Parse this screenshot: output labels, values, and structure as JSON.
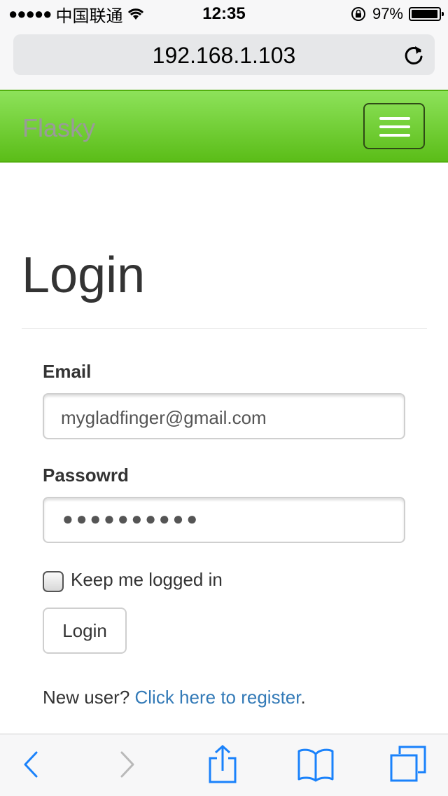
{
  "status_bar": {
    "carrier": "中国联通",
    "time": "12:35",
    "battery_percent": "97%",
    "battery_level": 0.97
  },
  "browser": {
    "url": "192.168.1.103"
  },
  "navbar": {
    "brand": "Flasky"
  },
  "page": {
    "title": "Login",
    "email_label": "Email",
    "email_value": "mygladfinger@gmail.com",
    "password_label": "Passowrd",
    "password_masked": "●●●●●●●●●●",
    "remember_label": "Keep me logged in",
    "remember_checked": false,
    "submit_label": "Login",
    "register_prefix": "New user? ",
    "register_link": "Click here to register",
    "register_suffix": "."
  },
  "toolbar": {
    "icons": [
      "back-icon",
      "forward-icon",
      "share-icon",
      "bookmarks-icon",
      "tabs-icon"
    ],
    "accent": "#1a82fb"
  },
  "colors": {
    "navbar_green": "#6fce33",
    "link_blue": "#337ab7"
  }
}
